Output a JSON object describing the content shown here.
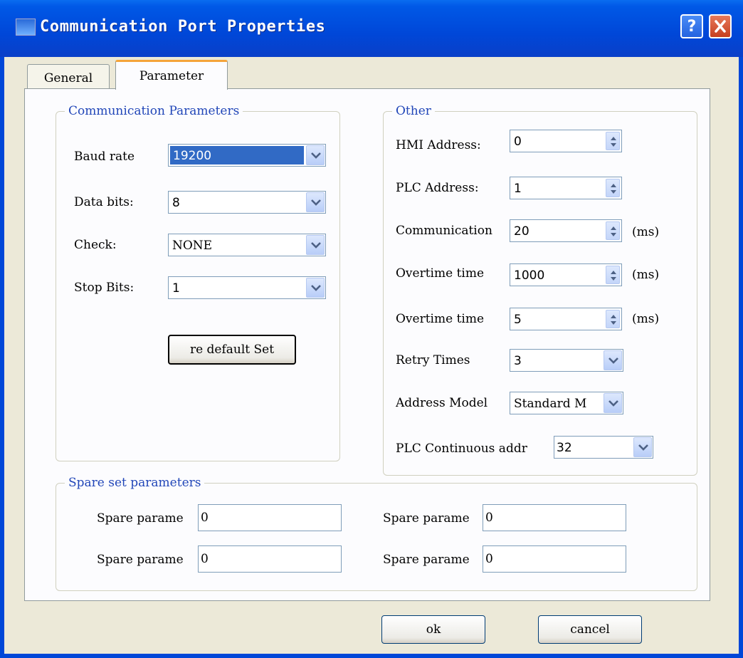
{
  "window": {
    "title": "Communication Port Properties",
    "help": "?",
    "close": "✕"
  },
  "tabs": [
    {
      "label": "General"
    },
    {
      "label": "Parameter"
    }
  ],
  "comm": {
    "legend": "Communication Parameters",
    "baud_label": "Baud rate",
    "baud_value": "19200",
    "databits_label": "Data bits:",
    "databits_value": "8",
    "check_label": "Check:",
    "check_value": "NONE",
    "stopbits_label": "Stop Bits:",
    "stopbits_value": "1",
    "restore_button": "re default Set"
  },
  "other": {
    "legend": "Other",
    "hmi_label": "HMI Address:",
    "hmi_value": "0",
    "plc_label": "PLC Address:",
    "plc_value": "1",
    "comm_label": "Communication",
    "comm_value": "20",
    "comm_unit": "(ms)",
    "ot1_label": "Overtime time",
    "ot1_value": "1000",
    "ot1_unit": "(ms)",
    "ot2_label": "Overtime time",
    "ot2_value": "5",
    "ot2_unit": "(ms)",
    "retry_label": "Retry Times",
    "retry_value": "3",
    "addr_label": "Address Model",
    "addr_value": "Standard M",
    "cont_label": "PLC Continuous addr",
    "cont_value": "32"
  },
  "spare": {
    "legend": "Spare set parameters",
    "items": [
      {
        "label": "Spare parame",
        "value": "0"
      },
      {
        "label": "Spare parame",
        "value": "0"
      },
      {
        "label": "Spare parame",
        "value": "0"
      },
      {
        "label": "Spare parame",
        "value": "0"
      }
    ]
  },
  "footer": {
    "ok": "ok",
    "cancel": "cancel"
  }
}
